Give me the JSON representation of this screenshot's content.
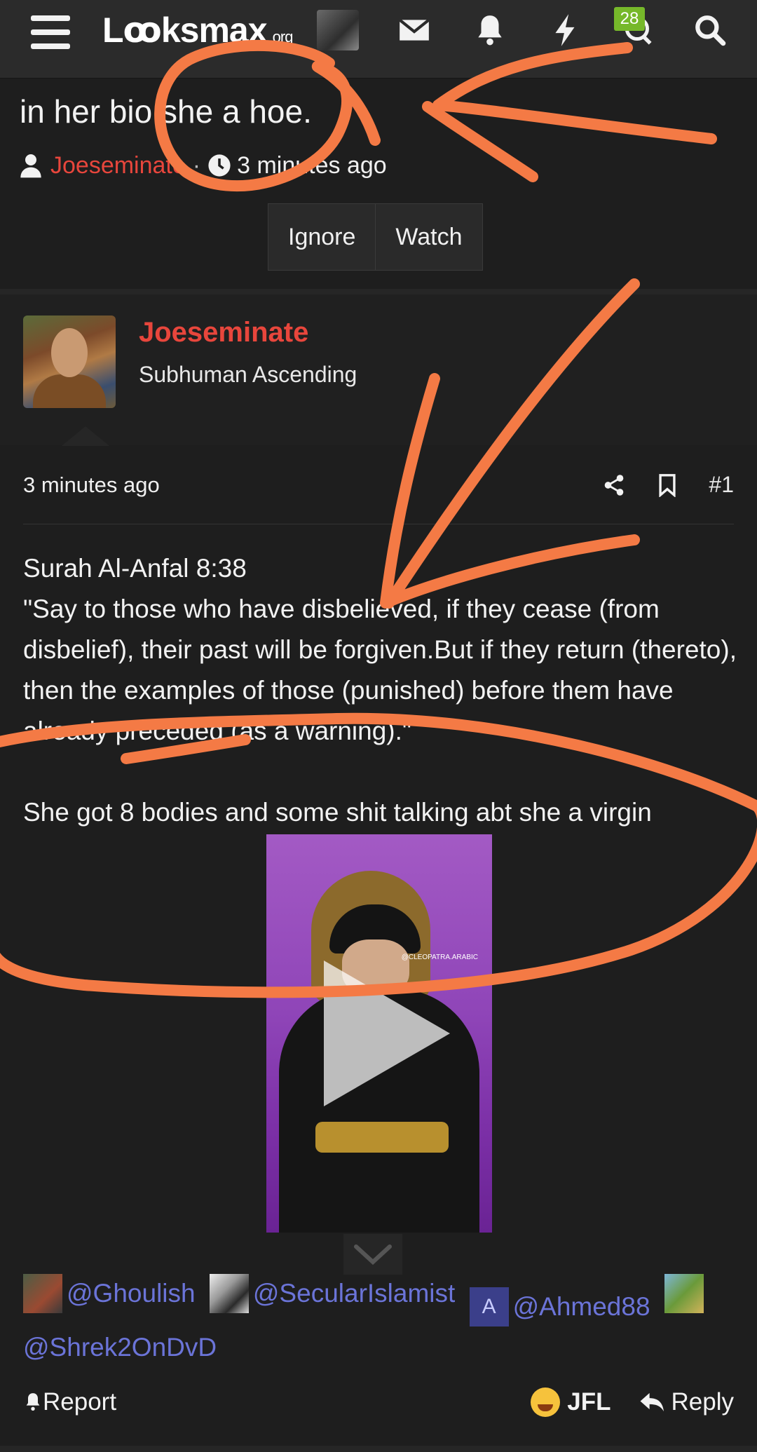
{
  "nav": {
    "logo_main": "Lꝏksmax",
    "logo_suffix": ".org",
    "badge_count": "28",
    "icons": [
      "menu-icon",
      "envelope-icon",
      "bell-icon",
      "bolt-icon",
      "chat-icon",
      "search-icon"
    ]
  },
  "thread": {
    "title": "in her bio she a hoe.",
    "author": "Joeseminate",
    "time": "3 minutes ago",
    "separator": "·",
    "ignore_label": "Ignore",
    "watch_label": "Watch"
  },
  "post": {
    "username": "Joeseminate",
    "user_title": "Subhuman Ascending",
    "time": "3 minutes ago",
    "number": "#1",
    "line1": "Surah Al-Anfal 8:38",
    "line2": "\"Say to those who have disbelieved, if they cease (from disbelief), their past will be forgiven.But if they return (thereto), then the examples of those (punished) before them have already preceded (as a warning).\"",
    "line3": "She got 8 bodies and some shit talking abt she a virgin",
    "video_handle": "@CLEOPATRA.ARABIC"
  },
  "mentions": [
    {
      "text": "@Ghoulish"
    },
    {
      "text": "@SecularIslamist"
    },
    {
      "text": "@Ahmed88",
      "avatar_letter": "A"
    },
    {
      "text": "@Shrek2OnDvD"
    }
  ],
  "footer": {
    "report_label": "Report",
    "reaction_label": "JFL",
    "reply_label": "Reply"
  },
  "colors": {
    "background": "#1e1e1e",
    "username_red": "#e8463c",
    "mention_blue": "#6b74d8",
    "badge_green": "#76b82a",
    "annotation_orange": "#f47a45"
  }
}
